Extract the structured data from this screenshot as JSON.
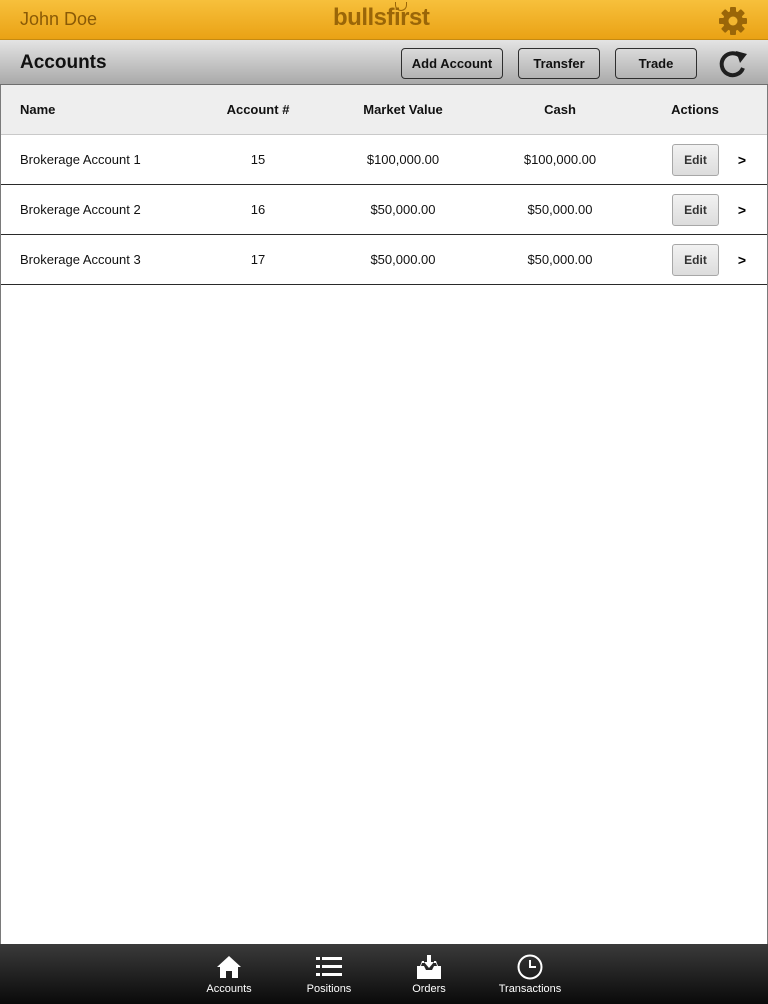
{
  "header": {
    "user_name": "John Doe",
    "brand": "bullsfirst",
    "settings_icon": "gear-icon"
  },
  "toolbar": {
    "title": "Accounts",
    "add_account_label": "Add Account",
    "transfer_label": "Transfer",
    "trade_label": "Trade",
    "refresh_icon": "refresh-icon"
  },
  "table": {
    "columns": [
      "Name",
      "Account #",
      "Market Value",
      "Cash",
      "Actions"
    ],
    "rows": [
      {
        "name": "Brokerage Account 1",
        "account": "15",
        "market_value": "$100,000.00",
        "cash": "$100,000.00",
        "edit": "Edit",
        "open": ">"
      },
      {
        "name": "Brokerage Account 2",
        "account": "16",
        "market_value": "$50,000.00",
        "cash": "$50,000.00",
        "edit": "Edit",
        "open": ">"
      },
      {
        "name": "Brokerage Account 3",
        "account": "17",
        "market_value": "$50,000.00",
        "cash": "$50,000.00",
        "edit": "Edit",
        "open": ">"
      }
    ]
  },
  "tabbar": {
    "tabs": [
      {
        "label": "Accounts",
        "icon": "home-icon"
      },
      {
        "label": "Positions",
        "icon": "list-icon"
      },
      {
        "label": "Orders",
        "icon": "inbox-icon"
      },
      {
        "label": "Transactions",
        "icon": "clock-icon"
      }
    ]
  },
  "colors": {
    "header_accent": "#f0b02a",
    "brand_text": "#9a6608",
    "tabbar_bg": "#1a1a1a"
  }
}
